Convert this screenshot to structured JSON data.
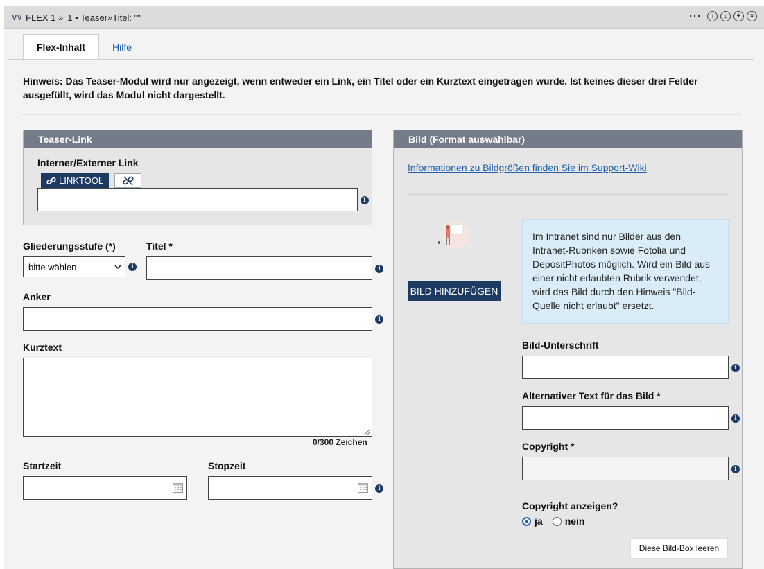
{
  "header": {
    "breadcrumb_prefix": "FLEX 1 »",
    "breadcrumb_item": "1 • Teaser»Titel: \"\""
  },
  "tabs": [
    {
      "label": "Flex-Inhalt",
      "active": true
    },
    {
      "label": "Hilfe",
      "active": false
    }
  ],
  "hint": "Hinweis: Das Teaser-Modul wird nur angezeigt, wenn entweder ein Link, ein Titel oder ein Kurztext eingetragen wurde. Ist keines dieser drei Felder ausgefüllt, wird das Modul nicht dargestellt.",
  "teaser_link": {
    "heading": "Teaser-Link",
    "label": "Interner/Externer Link",
    "linktool_label": "LINKTOOL",
    "value": ""
  },
  "form": {
    "gliederung_label": "Gliederungsstufe (*)",
    "gliederung_value": "bitte wählen",
    "titel_label": "Titel *",
    "titel_value": "",
    "anker_label": "Anker",
    "anker_value": "",
    "kurztext_label": "Kurztext",
    "kurztext_value": "",
    "counter": "0/300 Zeichen",
    "startzeit_label": "Startzeit",
    "stopzeit_label": "Stopzeit"
  },
  "image_box": {
    "heading": "Bild (Format auswählbar)",
    "wiki_link": "Informationen zu Bildgrößen finden Sie im Support-Wiki",
    "add_button": "BILD HINZUFÜGEN",
    "notice": "Im Intranet sind nur Bilder aus den Intranet-Rubriken sowie Fotolia und DepositPhotos möglich. Wird ein Bild aus einer nicht erlaubten Rubrik verwendet, wird das Bild durch den Hinweis \"Bild-Quelle nicht erlaubt\" ersetzt.",
    "caption_label": "Bild-Unterschrift",
    "alt_label": "Alternativer Text für das Bild *",
    "copyright_label": "Copyright *",
    "show_copyright_label": "Copyright anzeigen?",
    "radio_yes": "ja",
    "radio_no": "nein",
    "selected": "ja",
    "clear_button": "Diese Bild-Box leeren"
  },
  "colors": {
    "accent": "#1d3a63",
    "box_header": "#737c88",
    "notice_bg": "#d9ecf7",
    "link": "#1f5fae"
  }
}
